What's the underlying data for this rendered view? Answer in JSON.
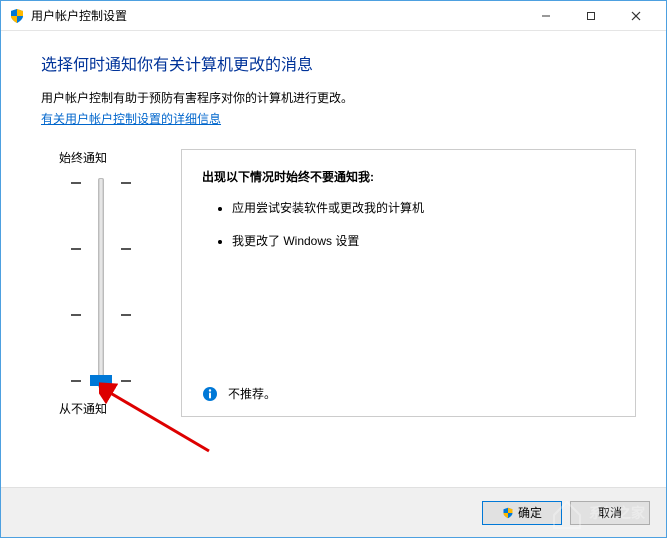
{
  "titlebar": {
    "title": "用户帐户控制设置"
  },
  "header": {
    "heading": "选择何时通知你有关计算机更改的消息",
    "desc": "用户帐户控制有助于预防有害程序对你的计算机进行更改。",
    "link": "有关用户帐户控制设置的详细信息"
  },
  "slider": {
    "top_label": "始终通知",
    "bottom_label": "从不通知",
    "position": 3
  },
  "panel": {
    "title": "出现以下情况时始终不要通知我:",
    "items": [
      "应用尝试安装软件或更改我的计算机",
      "我更改了 Windows 设置"
    ],
    "footer": "不推荐。"
  },
  "footer": {
    "ok": "确定",
    "cancel": "取消"
  }
}
